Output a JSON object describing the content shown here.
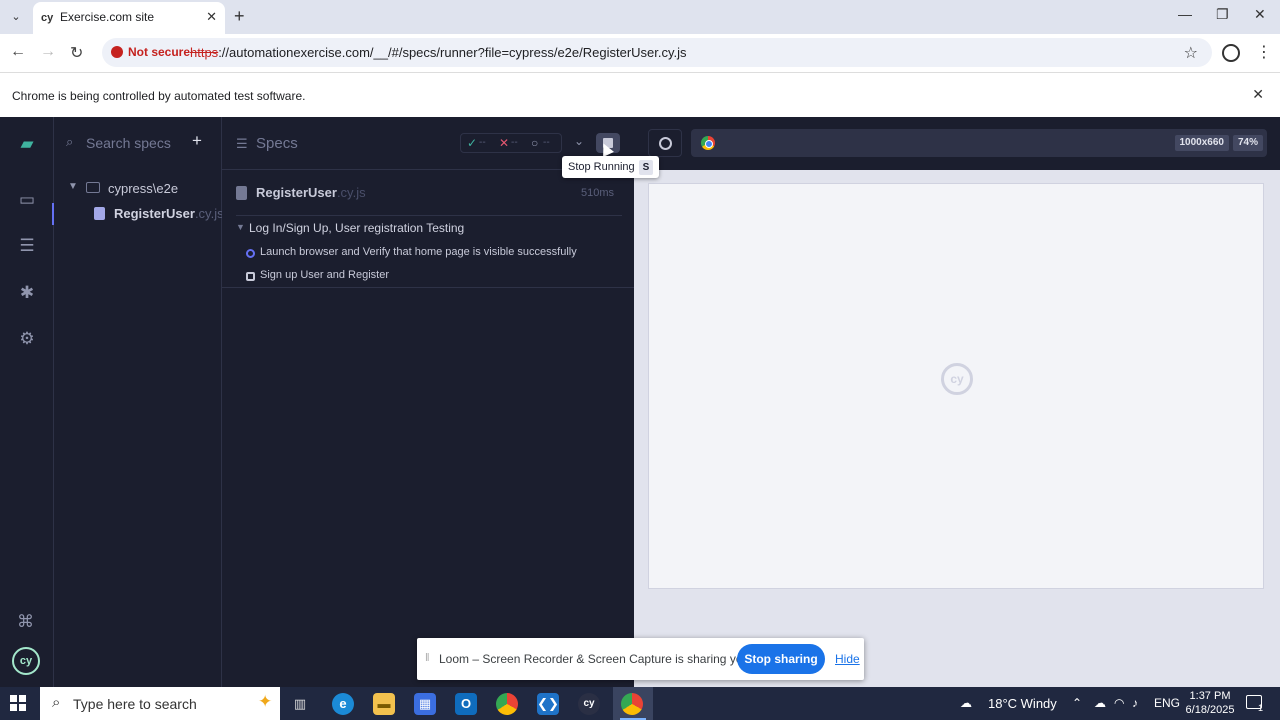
{
  "browser": {
    "tab_title": "Exercise.com site",
    "tab_favicon": "cy",
    "security_label": "Not secure",
    "url_scheme": "https",
    "url_rest": "://automationexercise.com/__/#/specs/runner?file=cypress/e2e/RegisterUser.cy.js",
    "infobar_text": "Chrome is being controlled by automated test software."
  },
  "sidebar": {
    "search_placeholder": "Search specs",
    "folder": "cypress\\e2e",
    "spec_name": "RegisterUser",
    "spec_ext": ".cy.js"
  },
  "reporter": {
    "header_label": "Specs",
    "stats": {
      "passed": "--",
      "failed": "--",
      "pending": "--"
    },
    "spec_title": "RegisterUser",
    "spec_ext": ".cy.js",
    "duration": "510ms",
    "suite_title": "Log In/Sign Up, User registration Testing",
    "tests": [
      {
        "title": "Launch browser and Verify that home page is visible successfully",
        "state": "running"
      },
      {
        "title": "Sign up User and Register",
        "state": "pending"
      }
    ],
    "tooltip_text": "Stop Running",
    "tooltip_key": "S"
  },
  "aut": {
    "viewport_size": "1000x660",
    "scale": "74%",
    "loader_text": "cy"
  },
  "loom": {
    "message": "Loom – Screen Recorder & Screen Capture is sharing your screen.",
    "stop_label": "Stop sharing",
    "hide_label": "Hide"
  },
  "taskbar": {
    "search_placeholder": "Type here to search",
    "weather": "18°C  Windy",
    "language": "ENG",
    "time": "1:37 PM",
    "date": "6/18/2025",
    "notification_count": "1"
  },
  "colors": {
    "cypress_bg": "#1b1e2e",
    "indigo": "#6470f3",
    "pass": "#3fb39f",
    "fail": "#e45770",
    "chrome_tabstrip": "#dfe3ee",
    "taskbar": "#202840",
    "loom_button": "#1a73e8"
  }
}
